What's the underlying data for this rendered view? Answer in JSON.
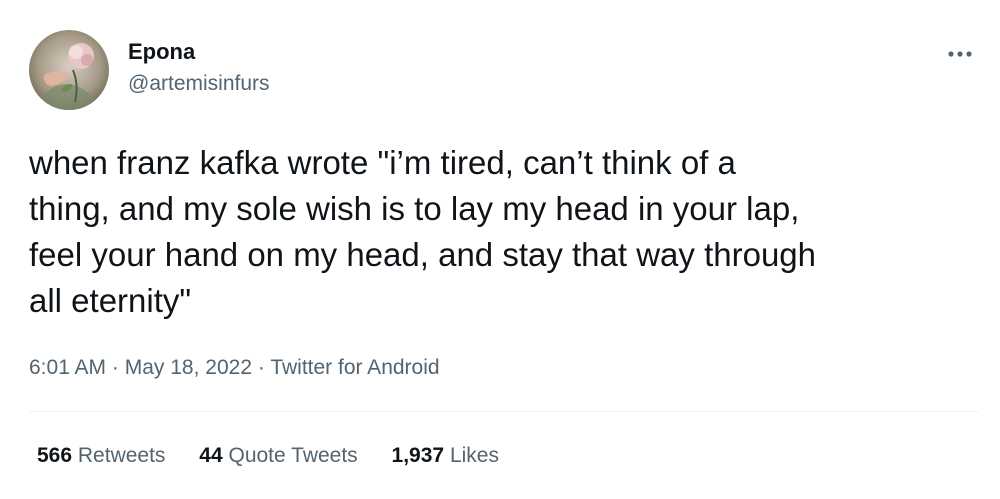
{
  "author": {
    "display_name": "Epona",
    "handle": "@artemisinfurs"
  },
  "tweet": {
    "text": "when franz kafka wrote \"i’m tired, can’t think of a\nthing, and my sole wish is to lay my head in your lap,\nfeel your hand on my head, and stay that way through\nall eternity\""
  },
  "meta": {
    "time": "6:01 AM",
    "separator": "·",
    "date": "May 18, 2022",
    "source": "Twitter for Android"
  },
  "stats": {
    "retweets": {
      "count": "566",
      "label": "Retweets"
    },
    "quote_tweets": {
      "count": "44",
      "label": "Quote Tweets"
    },
    "likes": {
      "count": "1,937",
      "label": "Likes"
    }
  },
  "icons": {
    "more": "more-horizontal-icon"
  },
  "colors": {
    "text_primary": "#0f1419",
    "text_secondary": "#536471",
    "divider": "#eff3f4"
  }
}
